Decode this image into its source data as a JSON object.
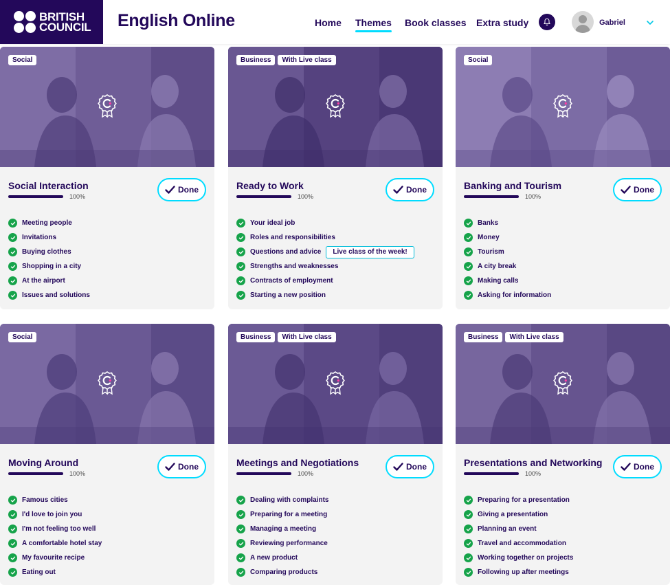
{
  "brand": {
    "line1": "BRITISH",
    "line2": "COUNCIL"
  },
  "app_title": "English Online",
  "nav": [
    {
      "label": "Home",
      "active": false
    },
    {
      "label": "Themes",
      "active": true
    },
    {
      "label": "Book classes",
      "active": false
    },
    {
      "label": "Extra study",
      "active": false
    }
  ],
  "user": {
    "name": "Gabriel"
  },
  "colors": {
    "brand": "#23085a",
    "accent": "#00dcff",
    "check": "#16a34a",
    "card_bg": "#f3f3f3"
  },
  "icons": {
    "bell": "bell-icon",
    "avatar": "user-avatar",
    "chevron": "chevron-down-icon",
    "badge": "achievement-badge-icon",
    "check": "check-icon"
  },
  "cards": [
    {
      "tags": [
        "Social"
      ],
      "title": "Social Interaction",
      "progress": 100,
      "progress_label": "100%",
      "done_label": "Done",
      "topics": [
        {
          "label": "Meeting people"
        },
        {
          "label": "Invitations"
        },
        {
          "label": "Buying clothes"
        },
        {
          "label": "Shopping in a city"
        },
        {
          "label": "At the airport"
        },
        {
          "label": "Issues and solutions"
        }
      ]
    },
    {
      "tags": [
        "Business",
        "With Live class"
      ],
      "title": "Ready to Work",
      "progress": 100,
      "progress_label": "100%",
      "done_label": "Done",
      "topics": [
        {
          "label": "Your ideal job"
        },
        {
          "label": "Roles and responsibilities"
        },
        {
          "label": "Questions and advice",
          "badge": "Live class of the week!"
        },
        {
          "label": "Strengths and weaknesses"
        },
        {
          "label": "Contracts of employment"
        },
        {
          "label": "Starting a new position"
        }
      ]
    },
    {
      "tags": [
        "Social"
      ],
      "title": "Banking and Tourism",
      "progress": 100,
      "progress_label": "100%",
      "done_label": "Done",
      "topics": [
        {
          "label": "Banks"
        },
        {
          "label": "Money"
        },
        {
          "label": "Tourism"
        },
        {
          "label": "A city break"
        },
        {
          "label": "Making calls"
        },
        {
          "label": "Asking for information"
        }
      ]
    },
    {
      "tags": [
        "Social"
      ],
      "title": "Moving Around",
      "progress": 100,
      "progress_label": "100%",
      "done_label": "Done",
      "topics": [
        {
          "label": "Famous cities"
        },
        {
          "label": "I'd love to join you"
        },
        {
          "label": "I'm not feeling too well"
        },
        {
          "label": "A comfortable hotel stay"
        },
        {
          "label": "My favourite recipe"
        },
        {
          "label": "Eating out"
        }
      ]
    },
    {
      "tags": [
        "Business",
        "With Live class"
      ],
      "title": "Meetings and Negotiations",
      "progress": 100,
      "progress_label": "100%",
      "done_label": "Done",
      "topics": [
        {
          "label": "Dealing with complaints"
        },
        {
          "label": "Preparing for a meeting"
        },
        {
          "label": "Managing a meeting"
        },
        {
          "label": "Reviewing performance"
        },
        {
          "label": "A new product"
        },
        {
          "label": "Comparing products"
        }
      ]
    },
    {
      "tags": [
        "Business",
        "With Live class"
      ],
      "title": "Presentations and Networking",
      "progress": 100,
      "progress_label": "100%",
      "done_label": "Done",
      "topics": [
        {
          "label": "Preparing for a presentation"
        },
        {
          "label": "Giving a presentation"
        },
        {
          "label": "Planning an event"
        },
        {
          "label": "Travel and accommodation"
        },
        {
          "label": "Working together on projects"
        },
        {
          "label": "Following up after meetings"
        }
      ]
    }
  ]
}
